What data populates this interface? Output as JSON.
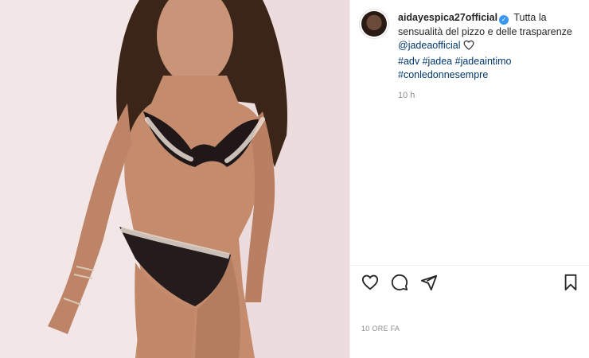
{
  "post": {
    "author": {
      "username": "aidayespica27official",
      "verified": true,
      "avatar_icon": "profile-avatar"
    },
    "caption": {
      "text_1": "Tutta la sensualità del pizzo e delle trasparenze",
      "mention": "@jadeaofficial",
      "emoji_icon": "heart-outline-icon",
      "hashtags": [
        "#adv",
        "#jadea",
        "#jadeaintimo",
        "#conledonnesempre"
      ],
      "age": "10 h"
    },
    "actions": {
      "like_icon": "heart-icon",
      "comment_icon": "comment-icon",
      "share_icon": "send-icon",
      "save_icon": "bookmark-icon"
    },
    "timestamp": "10 ORE FA"
  },
  "colors": {
    "text": "#262626",
    "link": "#00376b",
    "muted": "#8e8e8e",
    "verified": "#3897f0"
  }
}
